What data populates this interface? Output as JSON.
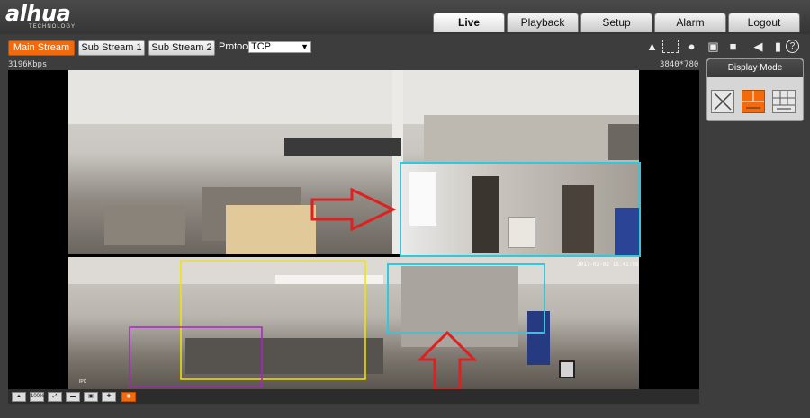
{
  "brand": {
    "name": "alhua",
    "sub": "TECHNOLOGY"
  },
  "tabs": [
    {
      "label": "Live",
      "active": true
    },
    {
      "label": "Playback",
      "active": false
    },
    {
      "label": "Setup",
      "active": false
    },
    {
      "label": "Alarm",
      "active": false
    },
    {
      "label": "Logout",
      "active": false
    }
  ],
  "toolbar": {
    "streams": [
      {
        "label": "Main Stream",
        "active": true
      },
      {
        "label": "Sub Stream 1",
        "active": false
      },
      {
        "label": "Sub Stream 2",
        "active": false
      }
    ],
    "protocol_label": "Protocol",
    "protocol_value": "TCP",
    "icons": [
      "person-icon",
      "region-icon",
      "snapshot-icon",
      "triple-snapshot-icon",
      "record-icon",
      "audio-icon",
      "microphone-icon",
      "help-icon"
    ]
  },
  "video": {
    "bitrate": "3196Kbps",
    "resolution": "3840*780",
    "timestamp": "2017-02-02 15:41:05",
    "camera_tag": "IPC"
  },
  "controls": [
    {
      "icon": "eagle-eye-icon",
      "label": ""
    },
    {
      "icon": "original-size-icon",
      "label": "100%"
    },
    {
      "icon": "fullscreen-icon",
      "label": ""
    },
    {
      "icon": "width-height-ratio-icon",
      "label": ""
    },
    {
      "icon": "fit-icon",
      "label": ""
    },
    {
      "icon": "ptz-icon",
      "label": ""
    },
    {
      "icon": "view-icon",
      "label": ""
    }
  ],
  "display_mode": {
    "title": "Display Mode",
    "options": [
      {
        "icon": "fullscreen-mode-icon",
        "active": false
      },
      {
        "icon": "split-mode-icon",
        "active": true
      },
      {
        "icon": "grid-mode-icon",
        "active": false
      }
    ]
  },
  "annotation_colors": {
    "arrow": "#e02020",
    "cyan": "#2ec8e0",
    "yellow": "#f2e400",
    "purple": "#b020c8"
  }
}
